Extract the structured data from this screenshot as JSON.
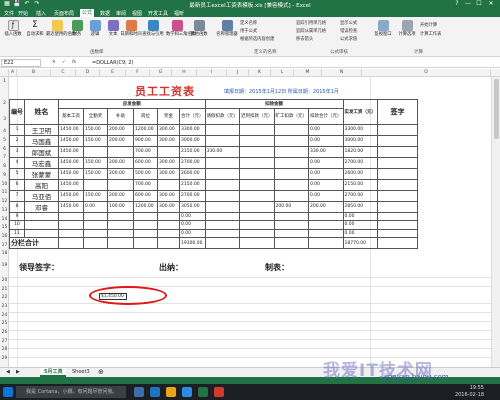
{
  "app": {
    "window_title": "最新员工excel工资表模板.xls [兼容模式] - Excel",
    "window_controls": [
      "?",
      "—",
      "☐",
      "✕"
    ]
  },
  "ribbon_tabs": [
    "文件",
    "开始",
    "插入",
    "页面布局",
    "公式",
    "数据",
    "审阅",
    "视图",
    "开发工具",
    "福昕"
  ],
  "active_tab": "公式",
  "ribbon": {
    "buttons": [
      "插入函数",
      "自动求和",
      "最近使用的函数",
      "财务",
      "逻辑",
      "文本",
      "日期和时间",
      "查找与引用",
      "数学和三角函数",
      "其他函数",
      "名称管理器",
      "追踪引用单元格",
      "计算选项"
    ],
    "small": [
      "定义名称",
      "用于公式",
      "根据所选内容创建",
      "追踪从属单元格",
      "移去箭头",
      "显示公式",
      "错误检查",
      "公式求值",
      "监视窗口",
      "开始计算",
      "计算工作表"
    ],
    "groups": [
      "函数库",
      "定义的名称",
      "公式审核",
      "计算"
    ]
  },
  "formula_bar": {
    "name_box": "E22",
    "fx": "fx",
    "formula": "=DOLLAR(C9, 2)"
  },
  "columns": [
    "A",
    "B",
    "C",
    "D",
    "E",
    "F",
    "G",
    "H",
    "I",
    "J",
    "K",
    "L",
    "M",
    "N",
    "O"
  ],
  "rows": [
    "1",
    "2",
    "3",
    "4",
    "5",
    "6",
    "7",
    "8",
    "9",
    "10",
    "11",
    "12",
    "13",
    "14",
    "15",
    "16",
    "17",
    "18",
    "19",
    "20",
    "21",
    "22",
    "23",
    "24",
    "25",
    "26",
    "27",
    "28",
    "29",
    "30",
    "31",
    "32"
  ],
  "sheet": {
    "title": "员工工资表",
    "date_line": "填报日期：2015年1月12日  所属日期：2015年1月",
    "headers": {
      "num": "编号",
      "name": "姓名",
      "payable": "应发金额",
      "deduct": "扣除金额",
      "net": "实发工资（元）",
      "sign": "签字",
      "base": "基本工资",
      "subsidy": "全勤奖",
      "bonus": "补助",
      "post": "岗位",
      "award": "奖金",
      "total": "合计（元）",
      "leave": "请假扣款（元）",
      "late": "迟到扣款（元）",
      "absent": "旷工扣款（元）",
      "ded_total": "扣款合计（元）"
    },
    "rows": [
      [
        "1",
        "王卫明",
        "1450.00",
        "150.00",
        "200.00",
        "1200.00",
        "300.00",
        "3300.00",
        "",
        "",
        "",
        "0.00",
        "3300.00"
      ],
      [
        "2",
        "马国鑫",
        "1450.00",
        "150.00",
        "200.00",
        "900.00",
        "300.00",
        "3000.00",
        "",
        "",
        "",
        "0.00",
        "3000.00"
      ],
      [
        "3",
        "郎国斌",
        "1450.00",
        "",
        "",
        "700.00",
        "",
        "2150.00",
        "330.00",
        "",
        "",
        "330.00",
        "1820.00"
      ],
      [
        "4",
        "马宏鑫",
        "1450.00",
        "150.00",
        "200.00",
        "600.00",
        "300.00",
        "2700.00",
        "",
        "",
        "",
        "0.00",
        "2700.00"
      ],
      [
        "5",
        "张蒙蒙",
        "1450.00",
        "150.00",
        "200.00",
        "500.00",
        "300.00",
        "2600.00",
        "",
        "",
        "",
        "0.00",
        "2600.00"
      ],
      [
        "6",
        "高阳",
        "1450.00",
        "",
        "",
        "700.00",
        "",
        "2150.00",
        "",
        "",
        "",
        "0.00",
        "2150.00"
      ],
      [
        "7",
        "马亚佰",
        "1450.00",
        "150.00",
        "200.00",
        "600.00",
        "300.00",
        "2700.00",
        "",
        "",
        "",
        "0.00",
        "2700.00"
      ],
      [
        "8",
        "邓睿",
        "1450.00",
        "0.00",
        "100.00",
        "1200.00",
        "300.00",
        "3050.00",
        "",
        "",
        "200.00",
        "200.00",
        "2850.00"
      ],
      [
        "9",
        "",
        "",
        "",
        "",
        "",
        "",
        "0.00",
        "",
        "",
        "",
        "",
        "0.00"
      ],
      [
        "10",
        "",
        "",
        "",
        "",
        "",
        "",
        "0.00",
        "",
        "",
        "",
        "",
        "0.00"
      ],
      [
        "11",
        "",
        "",
        "",
        "",
        "",
        "",
        "0.00",
        "",
        "",
        "",
        "",
        "0.00"
      ]
    ],
    "total_label": "分栏合计",
    "total_sum": "19300.00",
    "total_net": "18770.00",
    "sign_leader": "领导签字：",
    "sign_cashier": "出纳：",
    "sign_maker": "制表：",
    "cell_e22": "$1,450.00"
  },
  "sheet_tabs": [
    "5月工资",
    "Sheet3"
  ],
  "active_sheet_tab": "5月工资",
  "taskbar": {
    "search_placeholder": "我是 Cortana，小娜。有问题尽管问我。",
    "time": "19:55",
    "date": "2016-02-18"
  },
  "watermark": {
    "main": "我爱IT技术网",
    "url": "jingyan.baidu.com"
  },
  "colors": {
    "excel_green": "#217346",
    "title_red": "#d0312d",
    "annotation_red": "#e01818"
  }
}
